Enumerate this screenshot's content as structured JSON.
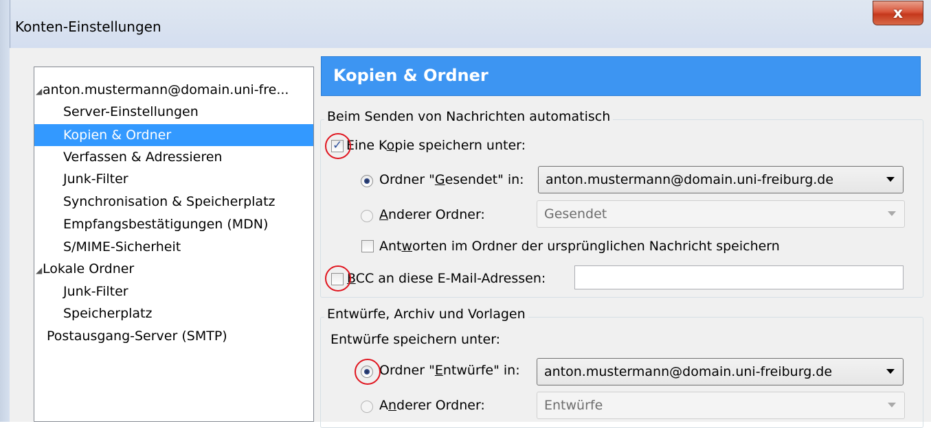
{
  "window": {
    "title": "Konten-Einstellungen",
    "close_label": "x"
  },
  "tree": {
    "items": [
      {
        "label": "anton.mustermann@domain.uni-fre...",
        "expanded": true
      },
      {
        "label": "Server-Einstellungen"
      },
      {
        "label": "Kopien & Ordner",
        "selected": true
      },
      {
        "label": "Verfassen & Adressieren"
      },
      {
        "label": "Junk-Filter"
      },
      {
        "label": "Synchronisation & Speicherplatz"
      },
      {
        "label": "Empfangsbestätigungen (MDN)"
      },
      {
        "label": "S/MIME-Sicherheit"
      },
      {
        "label": "Lokale Ordner",
        "expanded": true
      },
      {
        "label": "Junk-Filter"
      },
      {
        "label": "Speicherplatz"
      },
      {
        "label": "Postausgang-Server (SMTP)"
      }
    ]
  },
  "panel": {
    "header": "Kopien & Ordner",
    "sending": {
      "legend": "Beim Senden von Nachrichten automatisch",
      "save_copy": {
        "pre": "Eine K",
        "u": "o",
        "post": "pie speichern unter:",
        "checked": true
      },
      "sent_folder": {
        "pre": "Ordner \"",
        "u": "G",
        "post": "esendet\" in:",
        "checked": true,
        "select_value": "anton.mustermann@domain.uni-freiburg.de"
      },
      "other_folder": {
        "pre": "",
        "u": "A",
        "post": "nderer Ordner:",
        "checked": false,
        "select_value": "Gesendet"
      },
      "reply_in_folder": {
        "pre": "Ant",
        "u": "w",
        "post": "orten im Ordner der ursprünglichen Nachricht speichern",
        "checked": false
      },
      "bcc": {
        "pre": "",
        "u": "B",
        "post": "CC an diese E-Mail-Adressen:",
        "checked": false,
        "value": ""
      }
    },
    "drafts": {
      "legend": "Entwürfe, Archiv und Vorlagen",
      "save_label": "Entwürfe speichern unter:",
      "drafts_folder": {
        "pre": "Ordner \"",
        "u": "E",
        "post": "ntwürfe\" in:",
        "checked": true,
        "select_value": "anton.mustermann@domain.uni-freiburg.de"
      },
      "other_folder": {
        "pre": "A",
        "u": "n",
        "post": "derer Ordner:",
        "checked": false,
        "select_value": "Entwürfe"
      }
    }
  },
  "colors": {
    "header_bg": "#3d95f2",
    "selection": "#3399ff",
    "annotation_circle": "#e0141e"
  }
}
